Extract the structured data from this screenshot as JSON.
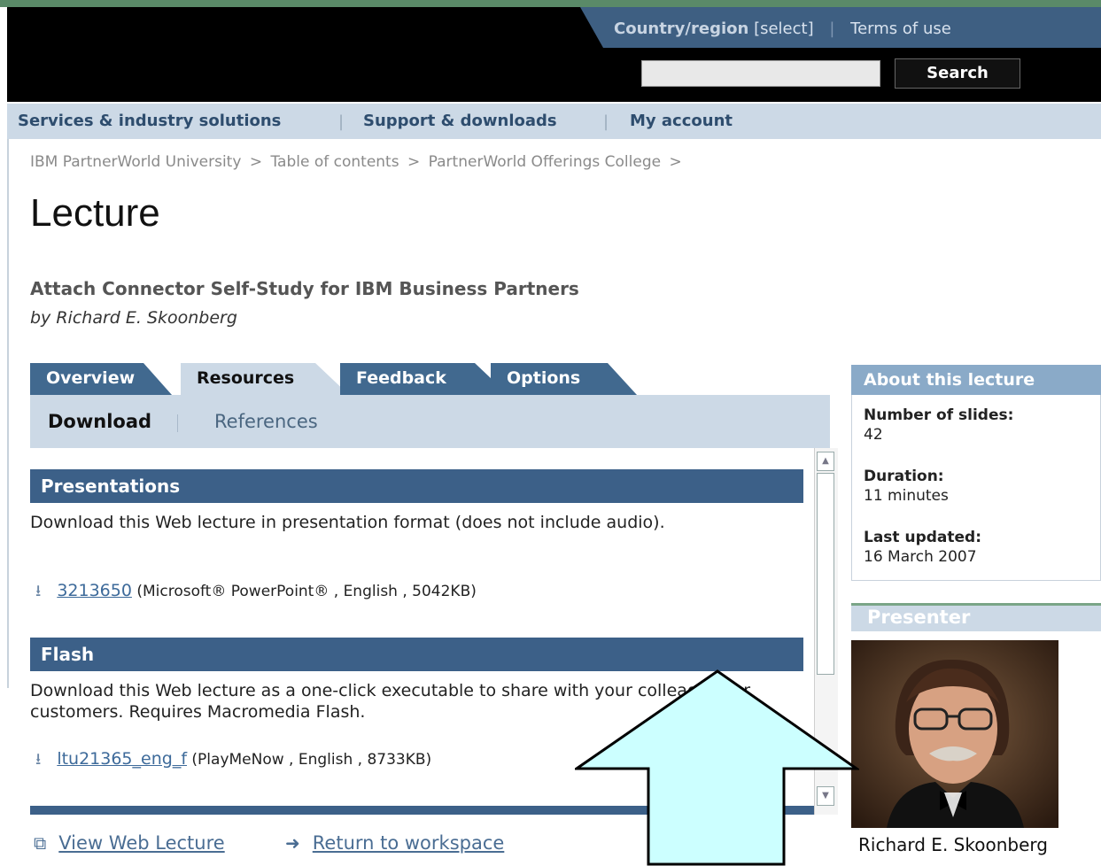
{
  "masthead": {
    "country_label": "Country/region",
    "country_select": "[select]",
    "terms": "Terms of use",
    "search_placeholder": "",
    "search_button": "Search"
  },
  "nav": {
    "items": [
      "Services & industry solutions",
      "Support & downloads",
      "My account"
    ]
  },
  "breadcrumbs": [
    "IBM PartnerWorld University",
    ">",
    "Table of contents",
    ">",
    "PartnerWorld Offerings College",
    ">"
  ],
  "page": {
    "title": "Lecture",
    "lecture_title": "Attach Connector Self-Study for IBM Business Partners",
    "author": "by Richard E. Skoonberg"
  },
  "tabs": [
    {
      "label": "Overview",
      "active": false
    },
    {
      "label": "Resources",
      "active": true
    },
    {
      "label": "Feedback",
      "active": false
    },
    {
      "label": "Options",
      "active": false
    }
  ],
  "subtabs": {
    "download": "Download",
    "references": "References"
  },
  "sections": {
    "presentations": {
      "heading": "Presentations",
      "description": "Download this Web lecture in presentation format (does not include audio).",
      "file_link": "3213650",
      "file_meta": "(Microsoft® PowerPoint® , English , 5042KB)"
    },
    "flash": {
      "heading": "Flash",
      "description": "Download this Web lecture as a one-click executable to share with your colleagues or customers. Requires Macromedia Flash.",
      "file_link": "ltu21365_eng_f",
      "file_meta": "(PlayMeNow , English , 8733KB)"
    }
  },
  "footer_links": {
    "view": "View Web Lecture",
    "return": "Return to workspace"
  },
  "about": {
    "heading": "About this lecture",
    "slides_label": "Number of slides:",
    "slides_value": "42",
    "duration_label": "Duration:",
    "duration_value": "11 minutes",
    "updated_label": "Last updated:",
    "updated_value": "16 March 2007"
  },
  "presenter": {
    "heading": "Presenter",
    "name": "Richard E. Skoonberg"
  },
  "colors": {
    "masthead_blue": "#3e5f82",
    "nav_bg": "#ccd9e6",
    "section_blue": "#3c6088",
    "arrow_fill": "#ccffff"
  },
  "icons": {
    "download": "download-arrow-icon",
    "new_window": "new-window-icon",
    "return": "arrow-right-icon",
    "annotation": "up-arrow-annotation"
  }
}
